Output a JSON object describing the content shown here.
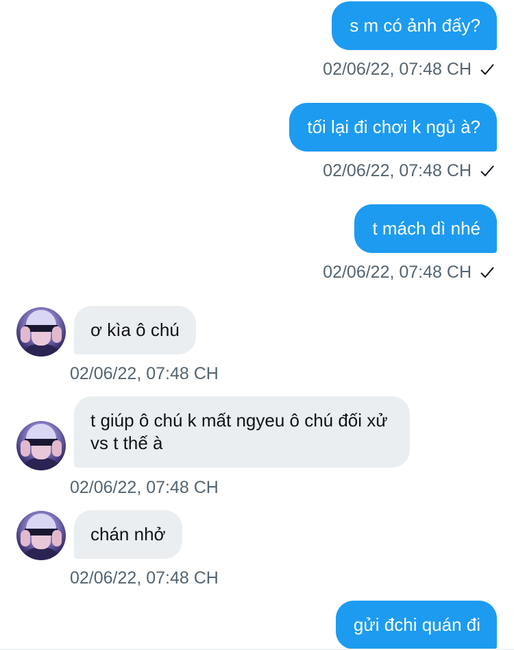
{
  "colors": {
    "sent_bubble": "#1d9bf0",
    "received_bubble": "#ebeef0",
    "timestamp": "#536471"
  },
  "messages": [
    {
      "direction": "sent",
      "text": "s m có ảnh đấy?",
      "timestamp": "02/06/22, 07:48 CH",
      "status_icon": "check-icon"
    },
    {
      "direction": "sent",
      "text": "tối lại đi chơi k ngủ à?",
      "timestamp": "02/06/22, 07:48 CH",
      "status_icon": "check-icon"
    },
    {
      "direction": "sent",
      "text": "t mách dì nhé",
      "timestamp": "02/06/22, 07:48 CH",
      "status_icon": "check-icon"
    },
    {
      "direction": "received",
      "text": "ơ kìa ô chú",
      "timestamp": "02/06/22, 07:48 CH"
    },
    {
      "direction": "received",
      "text": "t giúp ô chú k mất ngyeu ô chú đối xử vs t thế à",
      "timestamp": "02/06/22, 07:48 CH"
    },
    {
      "direction": "received",
      "text": "chán nhở",
      "timestamp": "02/06/22, 07:48 CH"
    },
    {
      "direction": "sent",
      "text": "gửi đchi quán đi"
    }
  ]
}
